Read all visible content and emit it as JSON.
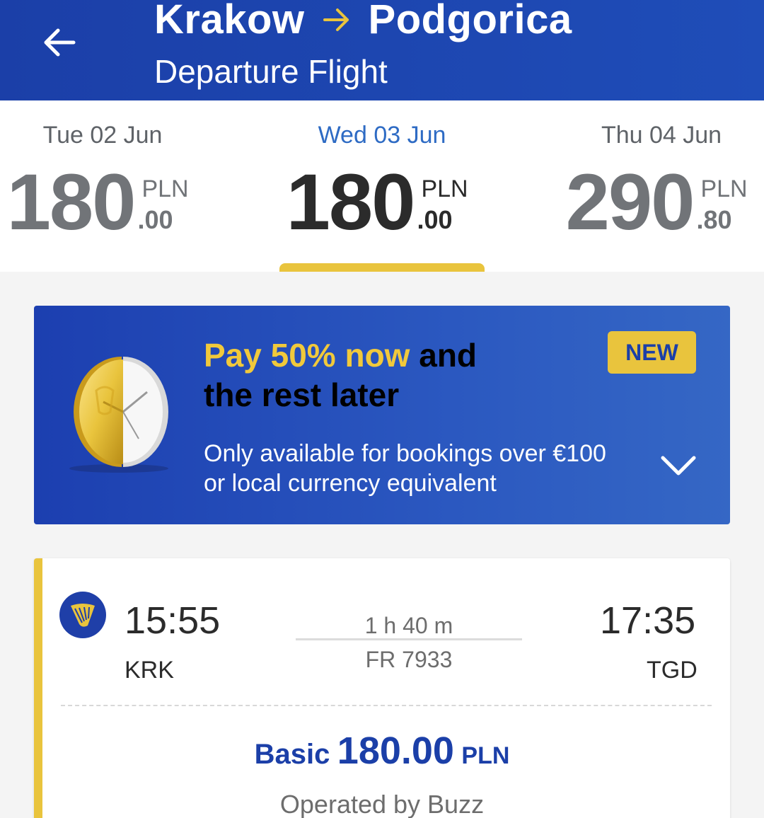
{
  "header": {
    "origin": "Krakow",
    "destination": "Podgorica",
    "subtitle": "Departure Flight"
  },
  "dates": [
    {
      "label": "Tue 02 Jun",
      "price_main": "180",
      "currency": "PLN",
      "price_decimal": ".00",
      "selected": false
    },
    {
      "label": "Wed 03 Jun",
      "price_main": "180",
      "currency": "PLN",
      "price_decimal": ".00",
      "selected": true
    },
    {
      "label": "Thu 04 Jun",
      "price_main": "290",
      "currency": "PLN",
      "price_decimal": ".80",
      "selected": false
    }
  ],
  "promo": {
    "title_highlight": "Pay 50% now",
    "title_rest_1": " and",
    "title_line_2": "the rest later",
    "desc_line_1": "Only available for bookings over €100",
    "desc_line_2": "or local currency equivalent",
    "badge": "NEW"
  },
  "flight": {
    "departure_time": "15:55",
    "departure_code": "KRK",
    "arrival_time": "17:35",
    "arrival_code": "TGD",
    "duration": "1 h 40 m",
    "flight_number": "FR 7933",
    "fare_type": "Basic",
    "fare_amount": "180.00",
    "fare_currency": "PLN",
    "operated_by": "Operated by Buzz"
  },
  "colors": {
    "brand_blue": "#1b3fa8",
    "accent_yellow": "#e9c43d",
    "selected_date": "#2e6bc4"
  },
  "icons": [
    "back-arrow-icon",
    "route-arrow-icon",
    "coin-clock-icon",
    "chevron-down-icon",
    "ryanair-harp-logo"
  ]
}
